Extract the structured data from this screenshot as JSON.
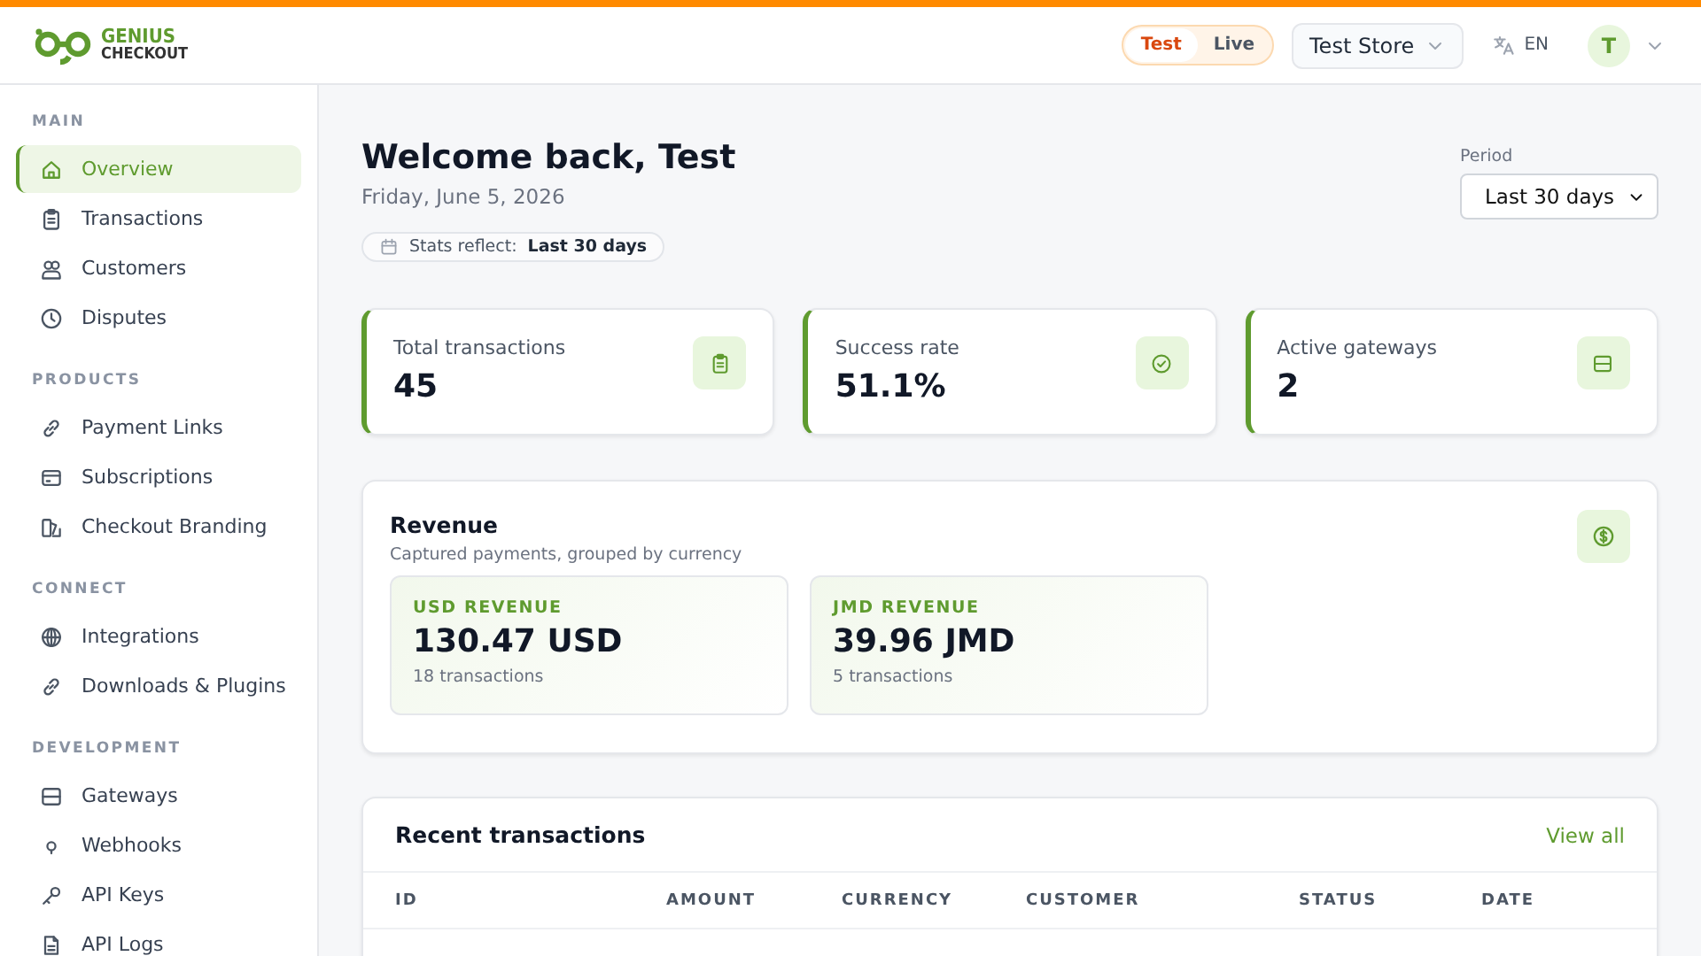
{
  "header": {
    "logo": {
      "line1": "GENIUS",
      "line2": "CHECKOUT"
    },
    "mode_toggle": [
      {
        "label": "Test",
        "selected": true
      },
      {
        "label": "Live",
        "selected": false
      }
    ],
    "store_picker": "Test Store",
    "language": "EN",
    "avatar": "T"
  },
  "sidebar": {
    "sections": [
      {
        "heading": "MAIN",
        "items": [
          {
            "label": "Overview",
            "kind": "home",
            "selected": true
          },
          {
            "label": "Transactions",
            "kind": "clipboard",
            "selected": false
          },
          {
            "label": "Customers",
            "kind": "users",
            "selected": false
          },
          {
            "label": "Disputes",
            "kind": "clock",
            "selected": false
          }
        ]
      },
      {
        "heading": "PRODUCTS",
        "items": [
          {
            "label": "Payment Links",
            "kind": "link",
            "selected": false
          },
          {
            "label": "Subscriptions",
            "kind": "card",
            "selected": false
          },
          {
            "label": "Checkout Branding",
            "kind": "brand",
            "selected": false
          }
        ]
      },
      {
        "heading": "CONNECT",
        "items": [
          {
            "label": "Integrations",
            "kind": "globe",
            "selected": false
          },
          {
            "label": "Downloads & Plugins",
            "kind": "link",
            "selected": false
          }
        ]
      },
      {
        "heading": "DEVELOPMENT",
        "items": [
          {
            "label": "Gateways",
            "kind": "server",
            "selected": false
          },
          {
            "label": "Webhooks",
            "kind": "hook",
            "selected": false
          },
          {
            "label": "API Keys",
            "kind": "key",
            "selected": false
          },
          {
            "label": "API Logs",
            "kind": "file",
            "selected": false
          }
        ]
      }
    ]
  },
  "main": {
    "title": "Welcome back, Test",
    "date": "Friday, June 5, 2026",
    "stats_note": {
      "label": "Stats reflect:",
      "value": "Last 30 days"
    },
    "period": {
      "label": "Period",
      "value": "Last 30 days"
    },
    "stat_cards": [
      {
        "label": "Total transactions",
        "value": "45",
        "kind": "clipboard"
      },
      {
        "label": "Success rate",
        "value": "51.1%",
        "kind": "check"
      },
      {
        "label": "Active gateways",
        "value": "2",
        "kind": "server"
      }
    ],
    "revenue": {
      "title": "Revenue",
      "subtitle": "Captured payments, grouped by currency",
      "currencies": [
        {
          "label": "USD REVENUE",
          "amount": "130.47 USD",
          "count": "18 transactions"
        },
        {
          "label": "JMD REVENUE",
          "amount": "39.96 JMD",
          "count": "5 transactions"
        }
      ]
    },
    "recent": {
      "title": "Recent transactions",
      "link": "View all",
      "columns": [
        "ID",
        "AMOUNT",
        "CURRENCY",
        "CUSTOMER",
        "STATUS",
        "DATE"
      ]
    }
  }
}
